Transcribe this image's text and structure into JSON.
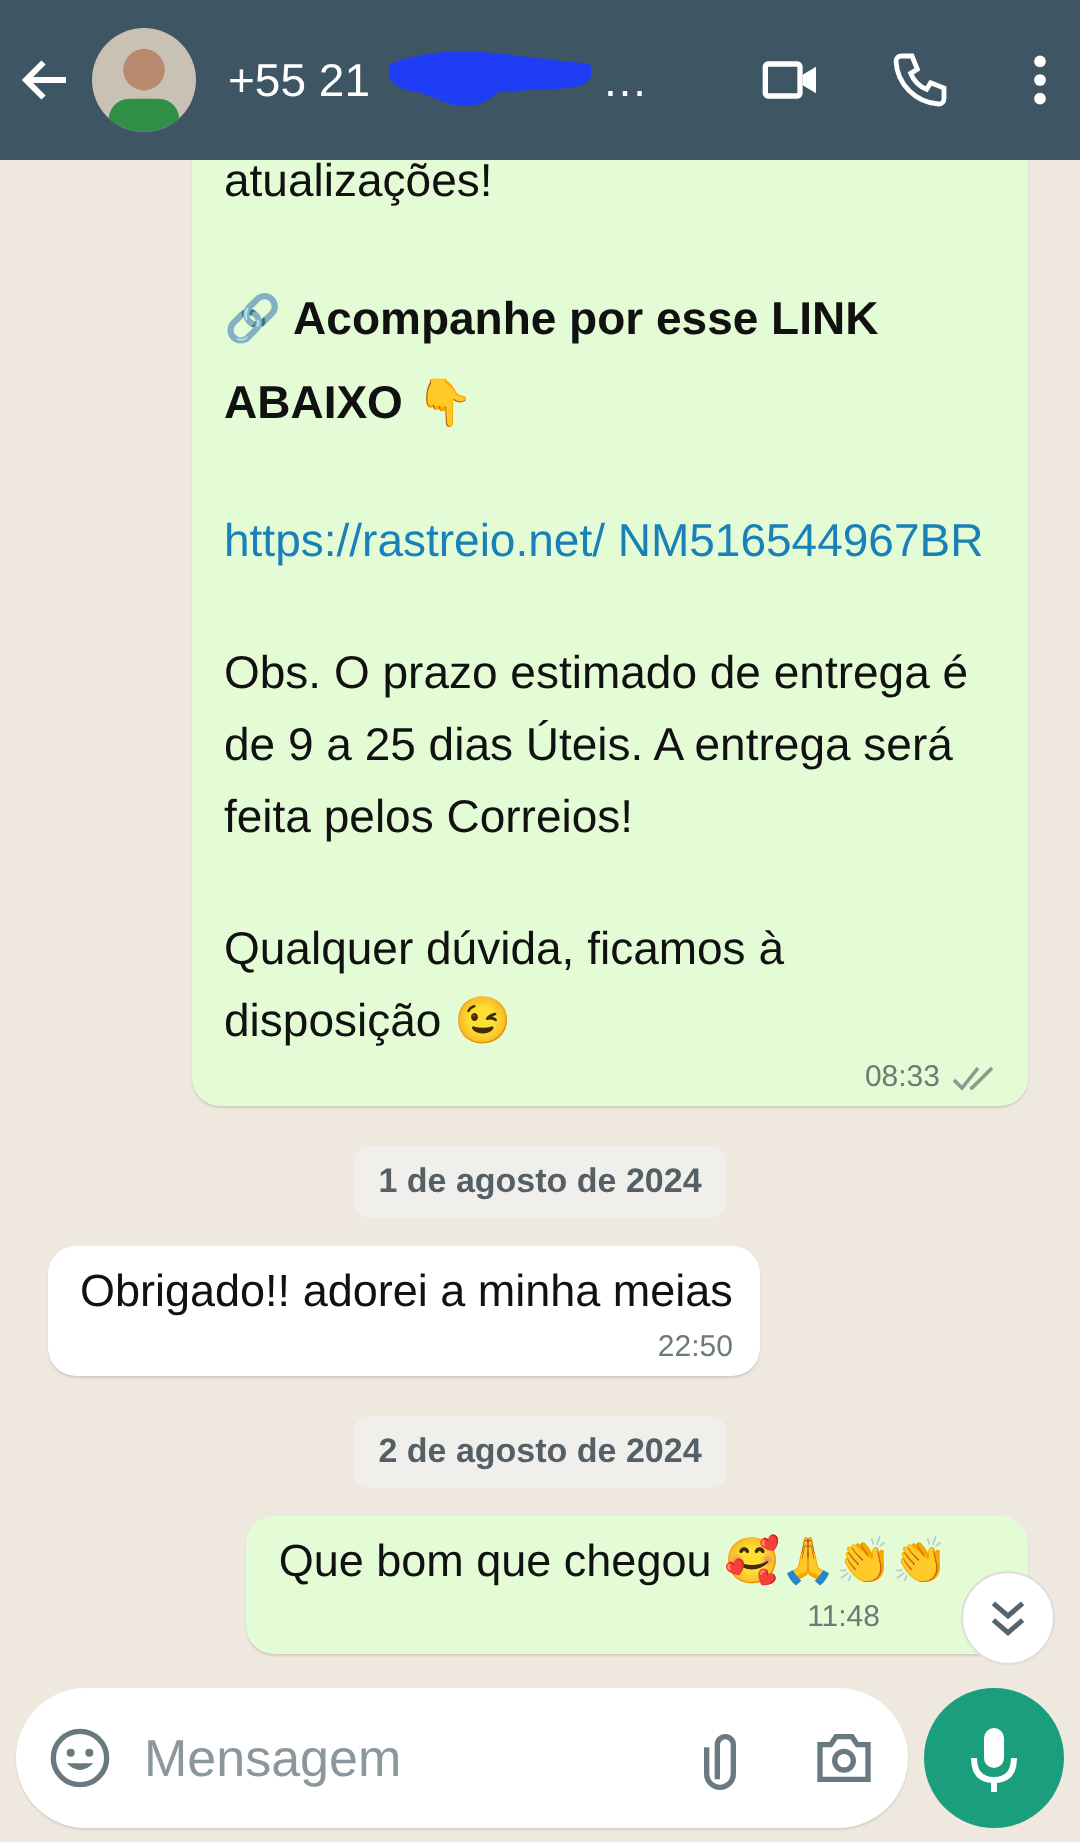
{
  "header": {
    "title": "+55 21",
    "title_tail": "…"
  },
  "messages": [
    {
      "kind": "out",
      "paragraphs": [
        {
          "text": "atualizações!",
          "kind": "text"
        },
        {
          "text": "🔗 Acompanhe por esse LINK ABAIXO 👇",
          "kind": "heading"
        },
        {
          "text": "https://rastreio.net/ NM516544967BR",
          "kind": "link"
        },
        {
          "text": "Obs. O prazo estimado de entrega é de 9 a 25 dias Úteis. A entrega será feita pelos Correios!",
          "kind": "text"
        },
        {
          "text": "Qualquer dúvida, ficamos à disposição 😉",
          "kind": "text"
        }
      ],
      "time": "08:33",
      "read": false
    },
    {
      "kind": "date",
      "text": "1 de agosto de 2024"
    },
    {
      "kind": "in",
      "paragraphs": [
        {
          "text": "Obrigado!! adorei a minha meias",
          "kind": "text"
        }
      ],
      "time": "22:50"
    },
    {
      "kind": "date",
      "text": "2 de agosto de 2024"
    },
    {
      "kind": "out",
      "paragraphs": [
        {
          "text": "Que bom que chegou 🥰🙏👏👏",
          "kind": "text"
        }
      ],
      "time": "11:48"
    }
  ],
  "composer": {
    "placeholder": "Mensagem"
  }
}
